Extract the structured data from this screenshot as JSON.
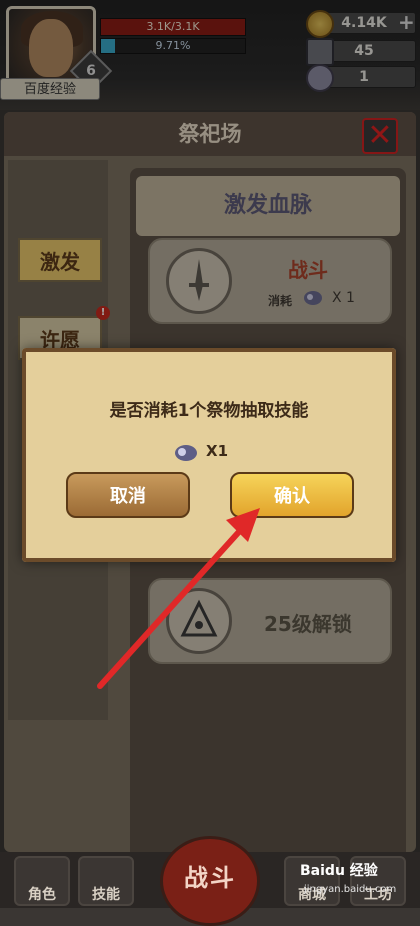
{
  "header": {
    "avatar_level": "6",
    "player_name": "百度经验",
    "hp_text": "3.1K/3.1K",
    "exp_text": "9.71%",
    "exp_fraction": 0.0971,
    "gold": "4.14K",
    "gems": "45",
    "rams": "1",
    "plus_icon": "+"
  },
  "panel": {
    "title": "祭祀场",
    "close_icon": "✕",
    "tabs": [
      {
        "label": "激发"
      },
      {
        "label": "许愿"
      }
    ],
    "badge": "!",
    "section_title": "激发血脉",
    "card1": {
      "title": "战斗",
      "cost_label": "消耗",
      "multiplier": "X 1"
    },
    "card2": {
      "title": "25级解锁"
    }
  },
  "dialog": {
    "message": "是否消耗1个祭物抽取技能",
    "multiplier": "X1",
    "cancel_label": "取消",
    "confirm_label": "确认"
  },
  "bottom_nav": {
    "items": [
      {
        "label": "角色"
      },
      {
        "label": "技能"
      },
      {
        "label": "商城"
      },
      {
        "label": "工坊"
      }
    ],
    "fight_label": "战斗"
  },
  "watermark": {
    "line1": "Baidu 经验",
    "line2": "jingyan.baidu.com"
  },
  "colors": {
    "accent_gold": "#e2a42c",
    "arrow_red": "#e02828",
    "hp_red": "#8b1c14",
    "exp_blue": "#3aa9c9"
  }
}
